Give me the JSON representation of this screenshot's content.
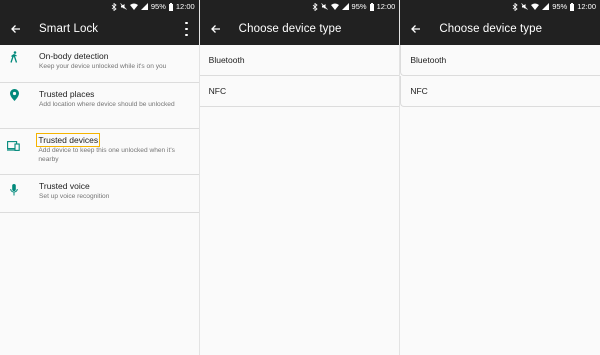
{
  "status_bar": {
    "battery_pct": "95%",
    "clock": "12:00"
  },
  "screens": [
    {
      "title": "Smart Lock",
      "items": [
        {
          "title": "On-body detection",
          "subtitle": "Keep your device unlocked while it's on you",
          "icon": "walking-person-icon"
        },
        {
          "title": "Trusted places",
          "subtitle": "Add location where device should be unlocked",
          "icon": "location-pin-icon"
        },
        {
          "title": "Trusted devices",
          "subtitle": "Add device to keep this one unlocked when it's nearby",
          "icon": "devices-icon"
        },
        {
          "title": "Trusted voice",
          "subtitle": "Set up voice recognition",
          "icon": "microphone-icon"
        }
      ]
    },
    {
      "title": "Choose device type",
      "items": [
        "Bluetooth",
        "NFC"
      ]
    },
    {
      "title": "Choose device type",
      "items": [
        "Bluetooth",
        "NFC"
      ]
    }
  ],
  "colors": {
    "toolbar": "#212121",
    "accent_teal": "#00897b",
    "highlight_border": "#f5b400"
  }
}
